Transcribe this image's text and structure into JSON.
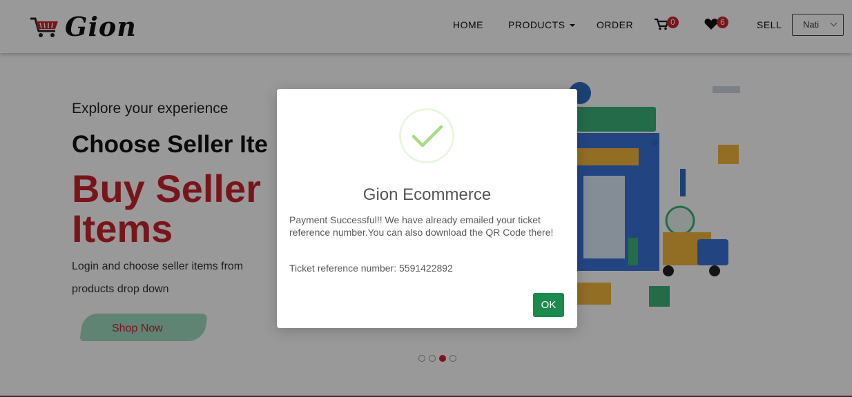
{
  "brand": {
    "name": "Gion"
  },
  "nav": {
    "home": "HOME",
    "products": "PRODUCTS",
    "order": "ORDER",
    "cart_count": "0",
    "wishlist_count": "6",
    "sell": "SELL",
    "user": "Nati"
  },
  "hero": {
    "subtitle": "Explore your experience",
    "heading": "Choose Seller Ite",
    "headline": "Buy Seller Items",
    "description": "Login and choose seller items from products drop down",
    "cta": "Shop Now",
    "carousel": {
      "total": 4,
      "active": 3
    }
  },
  "modal": {
    "title": "Gion Ecommerce",
    "message": "Payment Successful!! We have already emailed your ticket reference number.You can also download the QR Code there!",
    "reference": "Ticket reference number: 5591422892",
    "ok_label": "OK"
  },
  "colors": {
    "accent_red": "#c8232c",
    "success_green": "#1c8a4d",
    "check_green": "#a5dc86",
    "badge_red": "#c8262d"
  },
  "icons": [
    "cart-logo-icon",
    "caret-down-icon",
    "cart-icon",
    "heart-icon",
    "chevron-down-icon",
    "success-check-icon"
  ]
}
